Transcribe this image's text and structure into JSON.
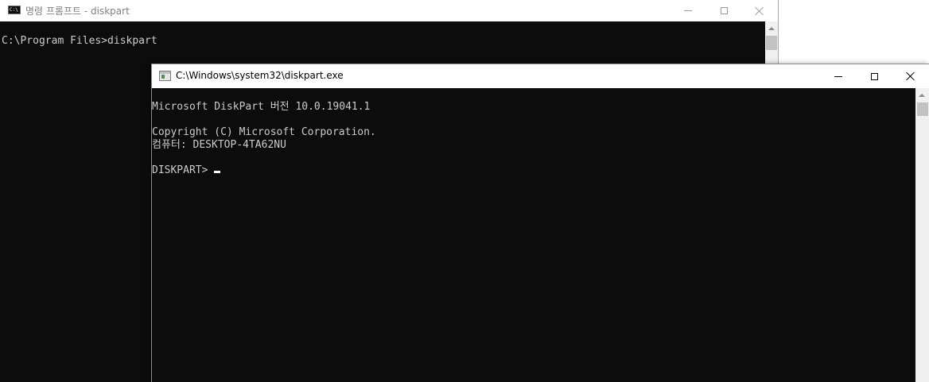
{
  "back_window": {
    "title": "명령 프롬프트 - diskpart",
    "icon": "cmd-icon",
    "icon_text": "C:\\",
    "console_lines": [
      "C:\\Program Files>diskpart"
    ],
    "controls": [
      "minimize-icon",
      "maximize-icon",
      "close-icon"
    ]
  },
  "front_window": {
    "title": "C:\\Windows\\system32\\diskpart.exe",
    "icon": "console-app-icon",
    "console_lines": {
      "version": "Microsoft DiskPart 버전 10.0.19041.1",
      "copyright": "Copyright (C) Microsoft Corporation.",
      "computer": "컴퓨터: DESKTOP-4TA62NU",
      "prompt": "DISKPART> "
    },
    "controls": [
      "minimize-icon",
      "maximize-icon",
      "close-icon"
    ]
  },
  "colors": {
    "console_bg": "#0c0c0c",
    "console_text": "#cccccc",
    "titlebar_bg": "#ffffff",
    "inactive_title_text": "#808080"
  }
}
